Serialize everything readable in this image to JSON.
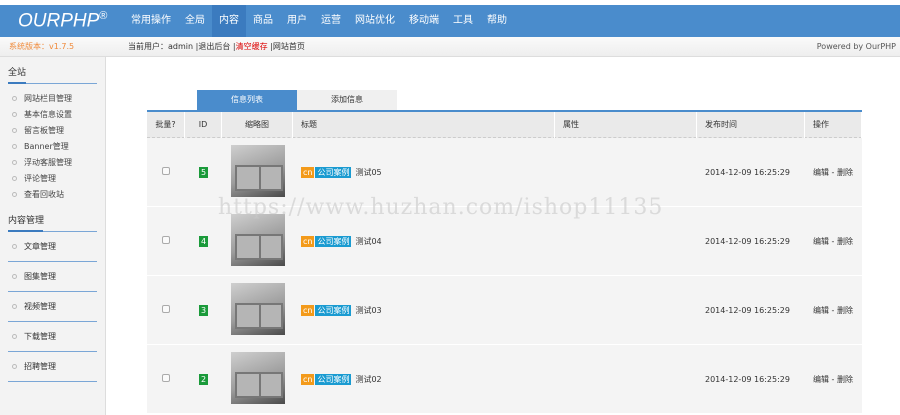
{
  "header": {
    "logo": "OURPHP",
    "logo_mark": "®",
    "nav": [
      "常用操作",
      "全局",
      "内容",
      "商品",
      "用户",
      "运营",
      "网站优化",
      "移动端",
      "工具",
      "帮助"
    ],
    "active_nav": 2
  },
  "subbar": {
    "version": "系统版本：v1.7.5",
    "current_user_label": "当前用户：",
    "user": "admin",
    "sep": "|",
    "logout": "退出后台",
    "clear_cache": "清空缓存",
    "home": "网站首页",
    "powered": "Powered by OurPHP"
  },
  "sidebar": {
    "section1": "全站",
    "items1": [
      "网站栏目管理",
      "基本信息设置",
      "留言板管理",
      "Banner管理",
      "浮动客服管理",
      "评论管理",
      "查看回收站"
    ],
    "section2": "内容管理",
    "items2": [
      "文章管理",
      "图集管理",
      "视频管理",
      "下载管理",
      "招聘管理"
    ]
  },
  "tabs": [
    "信息列表",
    "添加信息"
  ],
  "table": {
    "headers": [
      "批量?",
      "ID",
      "缩略图",
      "标题",
      "属性",
      "发布时间",
      "操作"
    ],
    "rows": [
      {
        "id": "5",
        "badge": "cn",
        "category": "公司案例",
        "title": "测试05",
        "attr": "",
        "time": "2014-12-09 16:25:29",
        "edit": "编辑",
        "sep": "-",
        "del": "删除"
      },
      {
        "id": "4",
        "badge": "cn",
        "category": "公司案例",
        "title": "测试04",
        "attr": "",
        "time": "2014-12-09 16:25:29",
        "edit": "编辑",
        "sep": "-",
        "del": "删除"
      },
      {
        "id": "3",
        "badge": "cn",
        "category": "公司案例",
        "title": "测试03",
        "attr": "",
        "time": "2014-12-09 16:25:29",
        "edit": "编辑",
        "sep": "-",
        "del": "删除"
      },
      {
        "id": "2",
        "badge": "cn",
        "category": "公司案例",
        "title": "测试02",
        "attr": "",
        "time": "2014-12-09 16:25:29",
        "edit": "编辑",
        "sep": "-",
        "del": "删除"
      }
    ]
  },
  "watermark": "https://www.huzhan.com/ishop11135"
}
